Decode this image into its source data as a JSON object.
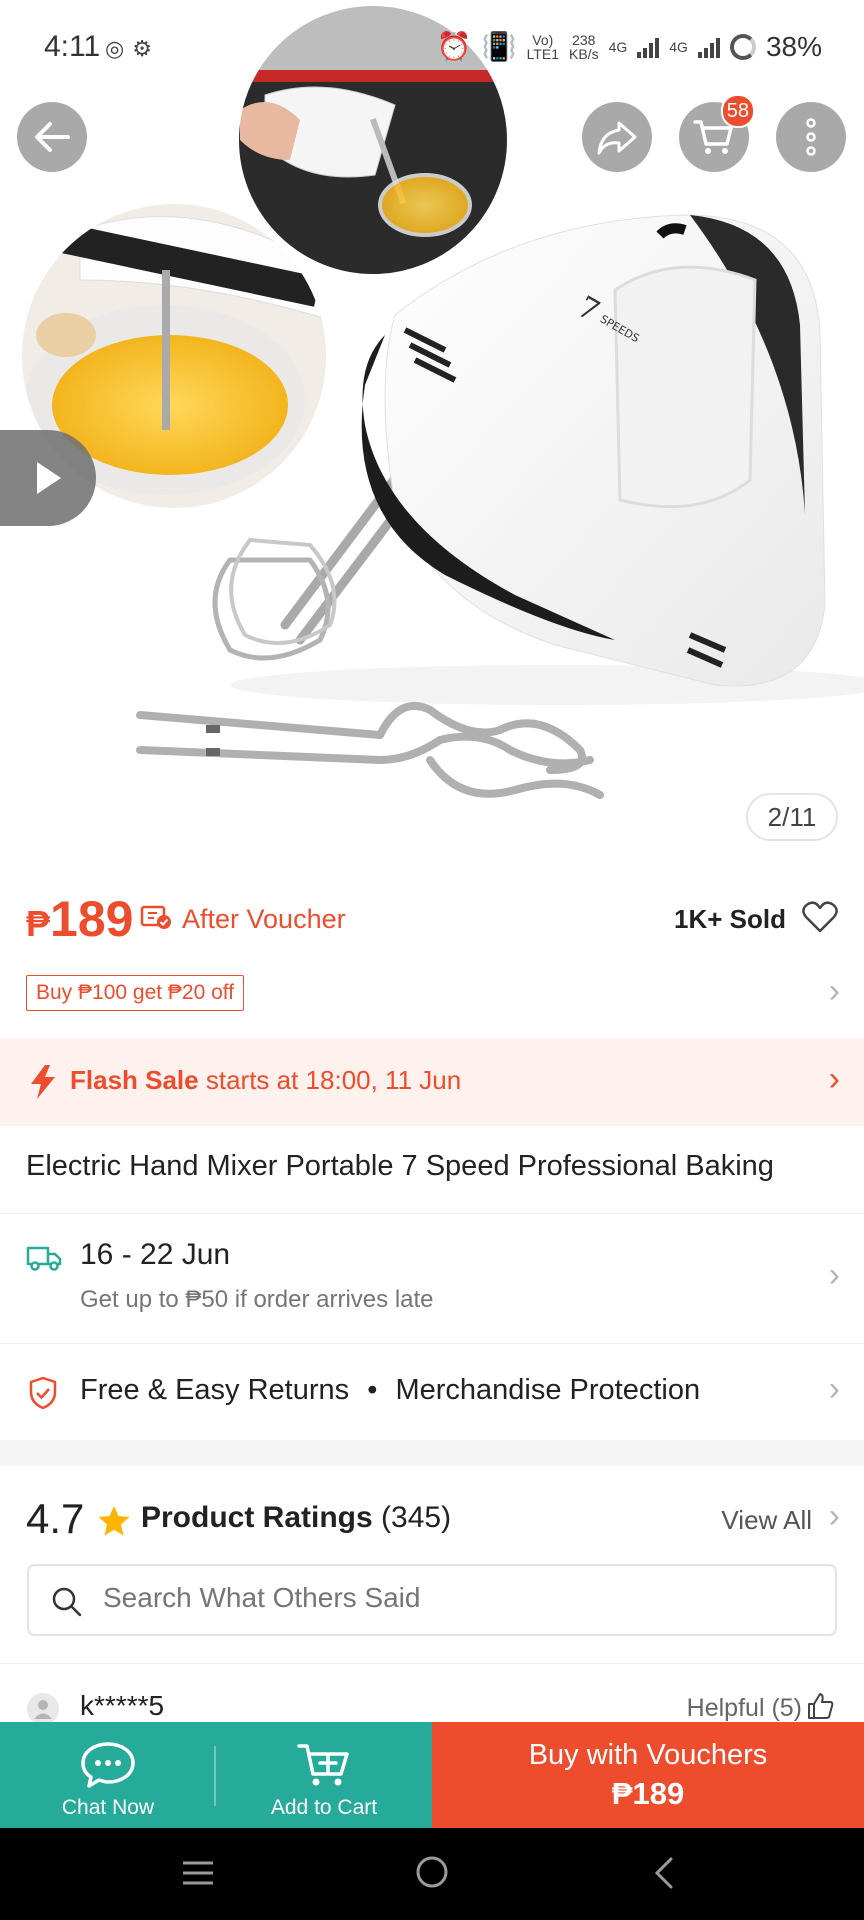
{
  "status_bar": {
    "time": "4:11",
    "net_speed": "238",
    "net_unit": "KB/s",
    "volte": "Vo)",
    "lte": "LTE1",
    "net1": "4G",
    "net2": "4G",
    "battery": "38%"
  },
  "header": {
    "cart_count": "58"
  },
  "gallery": {
    "page_indicator": "2/11"
  },
  "price": {
    "currency": "₱",
    "amount": "189",
    "after_voucher": "After Voucher",
    "sold": "1K+ Sold"
  },
  "promo": {
    "tag": "Buy ₱100 get ₱20 off"
  },
  "flash_sale": {
    "label": "Flash Sale",
    "text": " starts at 18:00, 11 Jun"
  },
  "product": {
    "title": "Electric Hand Mixer Portable 7 Speed Professional Baking"
  },
  "shipping": {
    "date": "16 - 22 Jun",
    "guarantee": "Get up to ₱50 if order arrives late"
  },
  "protection": {
    "returns": "Free & Easy Returns",
    "separator": "•",
    "merch": "Merchandise Protection"
  },
  "ratings": {
    "score": "4.7",
    "title": "Product Ratings",
    "count": "(345)",
    "view_all": "View All",
    "search_placeholder": "Search What Others Said"
  },
  "review": {
    "user": "k*****5",
    "helpful": "Helpful (5)"
  },
  "bottom_bar": {
    "chat": "Chat Now",
    "add_to_cart": "Add to Cart",
    "buy_label": "Buy with Vouchers",
    "buy_price": "₱189"
  },
  "colors": {
    "brand": "#ee4d2d",
    "teal": "#26aa99",
    "flash_bg": "#fff1ee"
  }
}
